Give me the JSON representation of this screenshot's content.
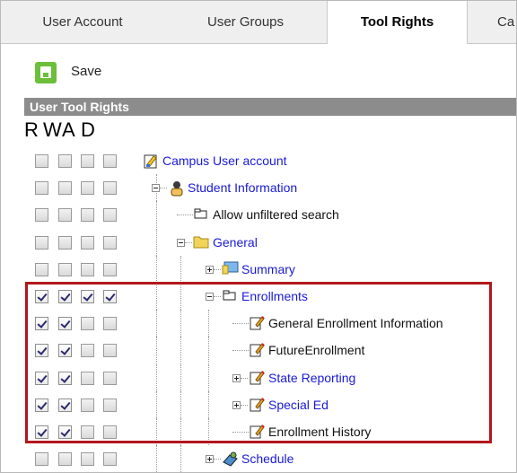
{
  "tabs": [
    {
      "label": "User Account",
      "active": false
    },
    {
      "label": "User Groups",
      "active": false
    },
    {
      "label": "Tool Rights",
      "active": true
    },
    {
      "label": "Ca",
      "active": false
    }
  ],
  "toolbar": {
    "save_label": "Save"
  },
  "section": {
    "title": "User Tool Rights"
  },
  "columns": [
    "R",
    "W",
    "A",
    "D"
  ],
  "tree": [
    {
      "label": "Campus User account",
      "link": true,
      "depth": 0,
      "icon": "campus-icon",
      "expander": "none",
      "rights": [
        false,
        false,
        false,
        false
      ]
    },
    {
      "label": "Student Information",
      "link": true,
      "depth": 1,
      "icon": "student-icon",
      "expander": "minus",
      "rights": [
        false,
        false,
        false,
        false
      ]
    },
    {
      "label": "Allow unfiltered search",
      "link": false,
      "depth": 2,
      "icon": "tool-icon",
      "expander": "none",
      "rights": [
        false,
        false,
        false,
        false
      ]
    },
    {
      "label": "General",
      "link": true,
      "depth": 2,
      "icon": "folder-icon",
      "expander": "minus",
      "rights": [
        false,
        false,
        false,
        false
      ]
    },
    {
      "label": "Summary",
      "link": true,
      "depth": 3,
      "icon": "summary-icon",
      "expander": "plus",
      "rights": [
        false,
        false,
        false,
        false
      ]
    },
    {
      "label": "Enrollments",
      "link": true,
      "depth": 3,
      "icon": "tool-icon",
      "expander": "minus",
      "rights": [
        true,
        true,
        true,
        true
      ]
    },
    {
      "label": "General Enrollment Information",
      "link": false,
      "depth": 4,
      "icon": "edit-icon",
      "expander": "none",
      "rights": [
        true,
        true,
        false,
        false
      ]
    },
    {
      "label": "FutureEnrollment",
      "link": false,
      "depth": 4,
      "icon": "edit-icon",
      "expander": "none",
      "rights": [
        true,
        true,
        false,
        false
      ]
    },
    {
      "label": "State Reporting",
      "link": true,
      "depth": 4,
      "icon": "edit-icon",
      "expander": "plus",
      "rights": [
        true,
        true,
        false,
        false
      ]
    },
    {
      "label": "Special Ed",
      "link": true,
      "depth": 4,
      "icon": "edit-icon",
      "expander": "plus",
      "rights": [
        true,
        true,
        false,
        false
      ]
    },
    {
      "label": "Enrollment History",
      "link": false,
      "depth": 4,
      "icon": "edit-icon",
      "expander": "none",
      "rights": [
        true,
        true,
        false,
        false
      ]
    },
    {
      "label": "Schedule",
      "link": true,
      "depth": 3,
      "icon": "schedule-icon",
      "expander": "plus",
      "rights": [
        false,
        false,
        false,
        false
      ]
    }
  ],
  "colors": {
    "link": "#1a1ad6",
    "highlight": "#b3161d",
    "header_bg": "#8c8c8c",
    "save_green": "#6bbf3a"
  }
}
